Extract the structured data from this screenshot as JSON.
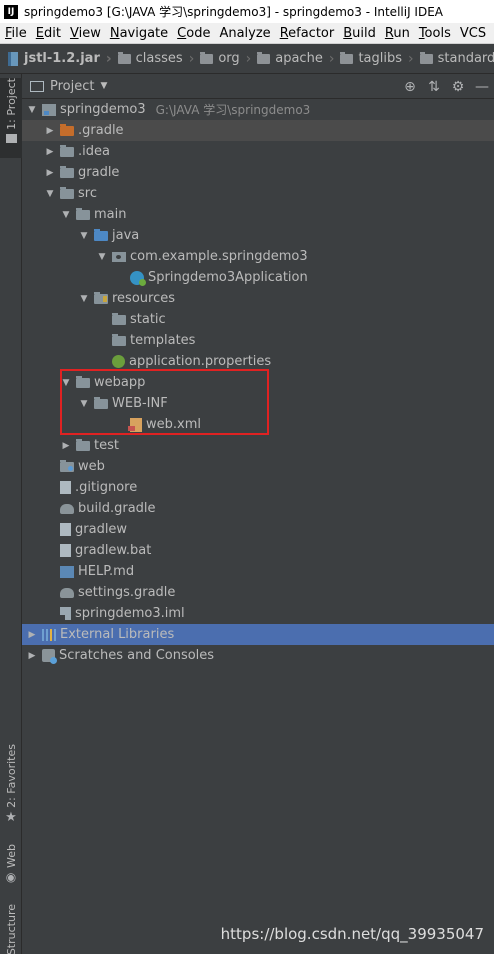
{
  "window": {
    "title": "springdemo3 [G:\\JAVA 学习\\springdemo3] - springdemo3 - IntelliJ IDEA",
    "logo": "IJ"
  },
  "menu": [
    {
      "mn": "F",
      "rest": "ile"
    },
    {
      "mn": "E",
      "rest": "dit"
    },
    {
      "mn": "V",
      "rest": "iew"
    },
    {
      "mn": "N",
      "rest": "avigate"
    },
    {
      "mn": "C",
      "rest": "ode"
    },
    {
      "mn": "",
      "rest": "Analyze"
    },
    {
      "mn": "R",
      "rest": "efactor"
    },
    {
      "mn": "B",
      "rest": "uild"
    },
    {
      "mn": "R",
      "rest": "un"
    },
    {
      "mn": "T",
      "rest": "ools"
    },
    {
      "mn": "",
      "rest": "VCS"
    }
  ],
  "breadcrumb": [
    "jstl-1.2.jar",
    "classes",
    "org",
    "apache",
    "taglibs",
    "standard"
  ],
  "left_tabs": {
    "project": "1: Project",
    "favorites": "2: Favorites",
    "web": "Web",
    "structure": "Structure"
  },
  "panel": {
    "title": "Project",
    "tool_icons": [
      "locate-icon",
      "collapse-icon",
      "gear-icon",
      "hide-icon"
    ]
  },
  "tree": [
    {
      "label": "springdemo3",
      "sub": "G:\\JAVA 学习\\springdemo3",
      "icon": "module-icon",
      "arrow": "down"
    },
    {
      "label": ".gradle",
      "icon": "folder-orange-icon",
      "arrow": "right"
    },
    {
      "label": ".idea",
      "icon": "folder-icon",
      "arrow": "right"
    },
    {
      "label": "gradle",
      "icon": "folder-icon",
      "arrow": "right"
    },
    {
      "label": "src",
      "icon": "folder-icon",
      "arrow": "down"
    },
    {
      "label": "main",
      "icon": "folder-icon",
      "arrow": "down"
    },
    {
      "label": "java",
      "icon": "folder-blue-icon",
      "arrow": "down"
    },
    {
      "label": "com.example.springdemo3",
      "icon": "package-icon",
      "arrow": "down"
    },
    {
      "label": "Springdemo3Application",
      "icon": "spring-class-icon",
      "arrow": "none"
    },
    {
      "label": "resources",
      "icon": "resources-folder-icon",
      "arrow": "down"
    },
    {
      "label": "static",
      "icon": "folder-icon",
      "arrow": "none"
    },
    {
      "label": "templates",
      "icon": "folder-icon",
      "arrow": "none"
    },
    {
      "label": "application.properties",
      "icon": "properties-icon",
      "arrow": "none"
    },
    {
      "label": "webapp",
      "icon": "folder-icon",
      "arrow": "down"
    },
    {
      "label": "WEB-INF",
      "icon": "folder-icon",
      "arrow": "down"
    },
    {
      "label": "web.xml",
      "icon": "xml-icon",
      "arrow": "none"
    },
    {
      "label": "test",
      "icon": "folder-icon",
      "arrow": "right"
    },
    {
      "label": "web",
      "icon": "web-folder-icon",
      "arrow": "none"
    },
    {
      "label": ".gitignore",
      "icon": "file-icon",
      "arrow": "none"
    },
    {
      "label": "build.gradle",
      "icon": "gradle-icon",
      "arrow": "none"
    },
    {
      "label": "gradlew",
      "icon": "file-icon",
      "arrow": "none"
    },
    {
      "label": "gradlew.bat",
      "icon": "file-icon",
      "arrow": "none"
    },
    {
      "label": "HELP.md",
      "icon": "markdown-icon",
      "arrow": "none"
    },
    {
      "label": "settings.gradle",
      "icon": "gradle-icon",
      "arrow": "none"
    },
    {
      "label": "springdemo3.iml",
      "icon": "iml-icon",
      "arrow": "none"
    },
    {
      "label": "External Libraries",
      "icon": "libraries-icon",
      "arrow": "right"
    },
    {
      "label": "Scratches and Consoles",
      "icon": "scratches-icon",
      "arrow": "right"
    }
  ],
  "watermark": "https://blog.csdn.net/qq_39935047",
  "colors": {
    "background": "#3c3f41",
    "selected_row": "#4b6eaf",
    "highlight_box": "#e02222"
  }
}
